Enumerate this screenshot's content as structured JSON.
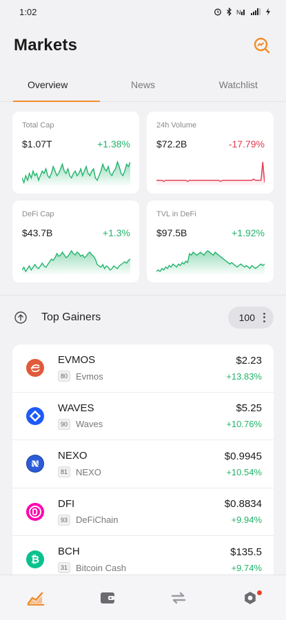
{
  "status_bar": {
    "time": "1:02"
  },
  "header": {
    "title": "Markets",
    "search_icon": "search-icon"
  },
  "tabs": [
    {
      "label": "Overview",
      "active": true
    },
    {
      "label": "News",
      "active": false
    },
    {
      "label": "Watchlist",
      "active": false
    }
  ],
  "cards": [
    {
      "label": "Total Cap",
      "value": "$1.07T",
      "change": "+1.38%",
      "trend": "up",
      "color": "#21b36b",
      "points": [
        14,
        12,
        15,
        13,
        16,
        14,
        17,
        15,
        16,
        13,
        15,
        17,
        16,
        18,
        15,
        14,
        16,
        19,
        17,
        15,
        16,
        18,
        20,
        17,
        16,
        18,
        15,
        14,
        16,
        17,
        15,
        16,
        18,
        15,
        17,
        19,
        16,
        15,
        17,
        18,
        14,
        13,
        15,
        17,
        20,
        18,
        17,
        19,
        16,
        15,
        17,
        18,
        21,
        19,
        16,
        15,
        17,
        20,
        19,
        21
      ]
    },
    {
      "label": "24h Volume",
      "value": "$72.2B",
      "change": "-17.79%",
      "trend": "down",
      "color": "#e2384d",
      "points": [
        8,
        8,
        8,
        8,
        7,
        8,
        8,
        8,
        8,
        8,
        8,
        8,
        8,
        8,
        8,
        8,
        8,
        7,
        8,
        8,
        8,
        8,
        8,
        8,
        8,
        8,
        8,
        8,
        8,
        8,
        8,
        8,
        8,
        8,
        8,
        7,
        8,
        8,
        8,
        8,
        8,
        8,
        8,
        8,
        8,
        8,
        8,
        8,
        8,
        8,
        8,
        8,
        8,
        9,
        8,
        8,
        8,
        8,
        24,
        6
      ]
    },
    {
      "label": "DeFi Cap",
      "value": "$43.7B",
      "change": "+1.3%",
      "trend": "up",
      "color": "#21b36b",
      "points": [
        10,
        12,
        9,
        11,
        13,
        10,
        12,
        14,
        12,
        11,
        13,
        15,
        13,
        12,
        14,
        16,
        18,
        17,
        19,
        22,
        20,
        21,
        23,
        21,
        19,
        20,
        22,
        24,
        22,
        21,
        23,
        22,
        20,
        21,
        19,
        20,
        22,
        23,
        21,
        20,
        18,
        14,
        13,
        12,
        14,
        11,
        13,
        12,
        10,
        11,
        13,
        12,
        11,
        13,
        14,
        15,
        16,
        15,
        17,
        18
      ]
    },
    {
      "label": "TVL in DeFi",
      "value": "$97.5B",
      "change": "+1.92%",
      "trend": "up",
      "color": "#21b36b",
      "points": [
        10,
        11,
        10,
        12,
        11,
        13,
        12,
        14,
        13,
        15,
        14,
        13,
        15,
        14,
        16,
        15,
        17,
        16,
        22,
        21,
        23,
        22,
        21,
        22,
        23,
        22,
        21,
        23,
        24,
        23,
        22,
        21,
        23,
        22,
        21,
        20,
        19,
        18,
        17,
        16,
        15,
        16,
        15,
        14,
        13,
        14,
        15,
        14,
        13,
        14,
        13,
        12,
        14,
        13,
        12,
        13,
        14,
        15,
        14,
        15
      ]
    }
  ],
  "section": {
    "title": "Top Gainers",
    "count": "100"
  },
  "coins": [
    {
      "symbol": "EVMOS",
      "rank": "80",
      "name": "Evmos",
      "price": "$2.23",
      "change": "+13.83%",
      "logo_color": "#e15a3a",
      "logo_icon": "evmos-icon"
    },
    {
      "symbol": "WAVES",
      "rank": "90",
      "name": "Waves",
      "price": "$5.25",
      "change": "+10.76%",
      "logo_color": "#1f5af6",
      "logo_icon": "waves-icon"
    },
    {
      "symbol": "NEXO",
      "rank": "81",
      "name": "NEXO",
      "price": "$0.9945",
      "change": "+10.54%",
      "logo_color": "#1a4199",
      "logo_icon": "nexo-icon"
    },
    {
      "symbol": "DFI",
      "rank": "93",
      "name": "DeFiChain",
      "price": "$0.8834",
      "change": "+9.94%",
      "logo_color": "#ff00af",
      "logo_icon": "defichain-icon"
    },
    {
      "symbol": "BCH",
      "rank": "31",
      "name": "Bitcoin Cash",
      "price": "$135.5",
      "change": "+9.74%",
      "logo_color": "#0ac18e",
      "logo_icon": "bitcoin-cash-icon"
    }
  ],
  "bottom_nav": [
    {
      "icon": "markets-icon",
      "active": true
    },
    {
      "icon": "wallet-icon",
      "active": false
    },
    {
      "icon": "swap-icon",
      "active": false
    },
    {
      "icon": "settings-icon",
      "active": false,
      "badge": true
    }
  ],
  "colors": {
    "accent": "#f28c28",
    "up": "#21b36b",
    "down": "#e2384d"
  }
}
